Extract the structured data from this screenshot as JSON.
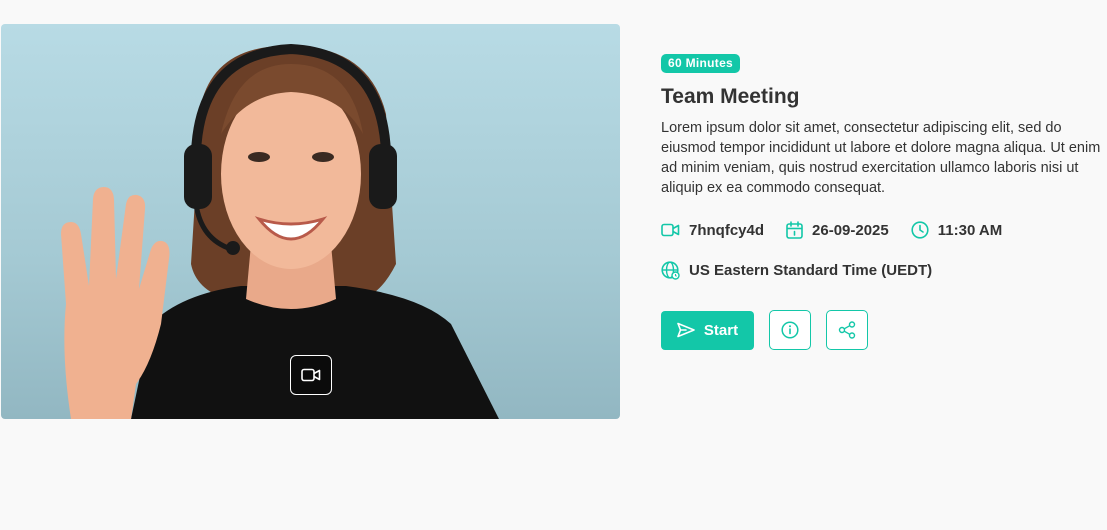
{
  "meeting": {
    "duration_badge": "60 Minutes",
    "title": "Team Meeting",
    "description": "Lorem ipsum dolor sit amet, consectetur adipiscing elit, sed do eiusmod tempor incididunt ut labore et dolore magna aliqua. Ut enim ad minim veniam, quis nostrud exercitation ullamco laboris nisi ut aliquip ex ea commodo consequat.",
    "meeting_id": "7hnqfcy4d",
    "date": "26-09-2025",
    "time": "11:30 AM",
    "timezone": "US Eastern Standard Time (UEDT)"
  },
  "actions": {
    "start_label": "Start"
  },
  "icons": {
    "video": "video-camera-icon",
    "calendar": "calendar-icon",
    "clock": "clock-icon",
    "globe": "globe-icon",
    "send": "send-icon",
    "info": "info-icon",
    "share": "share-icon"
  },
  "colors": {
    "accent": "#13c7a8",
    "text": "#333333",
    "background": "#f9f9f9"
  }
}
